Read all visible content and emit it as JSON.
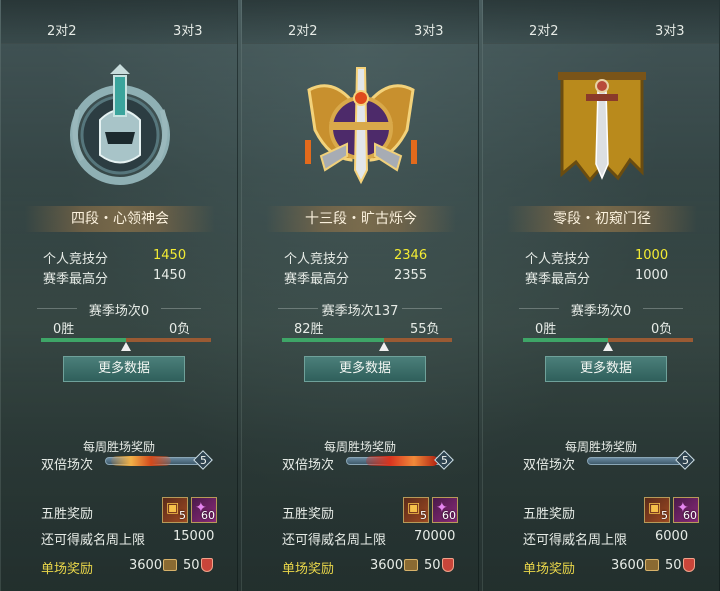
{
  "panels": [
    {
      "tab_left": "2对2",
      "tab_right": "3对3",
      "emblem": "silver-helmet-emblem-icon",
      "rank_title": "四段・心领神会",
      "personal_label": "个人竞技分",
      "personal_value": "1450",
      "season_high_label": "赛季最高分",
      "season_high_value": "1450",
      "season_matches": "赛季场次0",
      "wins": "0胜",
      "losses": "0负",
      "win_ratio": 0.5,
      "more_button": "更多数据",
      "weekly_title": "每周胜场奖励",
      "double_label": "双倍场次",
      "double_count": "5",
      "five_win_label": "五胜奖励",
      "item1_count": "5",
      "item2_count": "60",
      "limit_label": "还可得威名周上限",
      "limit_value": "15000",
      "single_label": "单场奖励",
      "single_coins": "3600",
      "single_points": "50"
    },
    {
      "tab_left": "2对2",
      "tab_right": "3对3",
      "emblem": "gold-winged-sword-emblem-icon",
      "rank_title": "十三段・旷古烁今",
      "personal_label": "个人竞技分",
      "personal_value": "2346",
      "season_high_label": "赛季最高分",
      "season_high_value": "2355",
      "season_matches": "赛季场次137",
      "wins": "82胜",
      "losses": "55负",
      "win_ratio": 0.6,
      "more_button": "更多数据",
      "weekly_title": "每周胜场奖励",
      "double_label": "双倍场次",
      "double_count": "5",
      "five_win_label": "五胜奖励",
      "item1_count": "5",
      "item2_count": "60",
      "limit_label": "还可得威名周上限",
      "limit_value": "70000",
      "single_label": "单场奖励",
      "single_coins": "3600",
      "single_points": "50"
    },
    {
      "tab_left": "2对2",
      "tab_right": "3对3",
      "emblem": "banner-sword-emblem-icon",
      "rank_title": "零段・初窥门径",
      "personal_label": "个人竞技分",
      "personal_value": "1000",
      "season_high_label": "赛季最高分",
      "season_high_value": "1000",
      "season_matches": "赛季场次0",
      "wins": "0胜",
      "losses": "0负",
      "win_ratio": 0.5,
      "more_button": "更多数据",
      "weekly_title": "每周胜场奖励",
      "double_label": "双倍场次",
      "double_count": "5",
      "five_win_label": "五胜奖励",
      "item1_count": "5",
      "item2_count": "60",
      "limit_label": "还可得威名周上限",
      "limit_value": "6000",
      "single_label": "单场奖励",
      "single_coins": "3600",
      "single_points": "50"
    }
  ],
  "colors": {
    "highlight": "#f4ec34",
    "win_bar": "#3ea567",
    "loss_bar": "#9a5a33",
    "single_reward": "#e9d64a"
  }
}
